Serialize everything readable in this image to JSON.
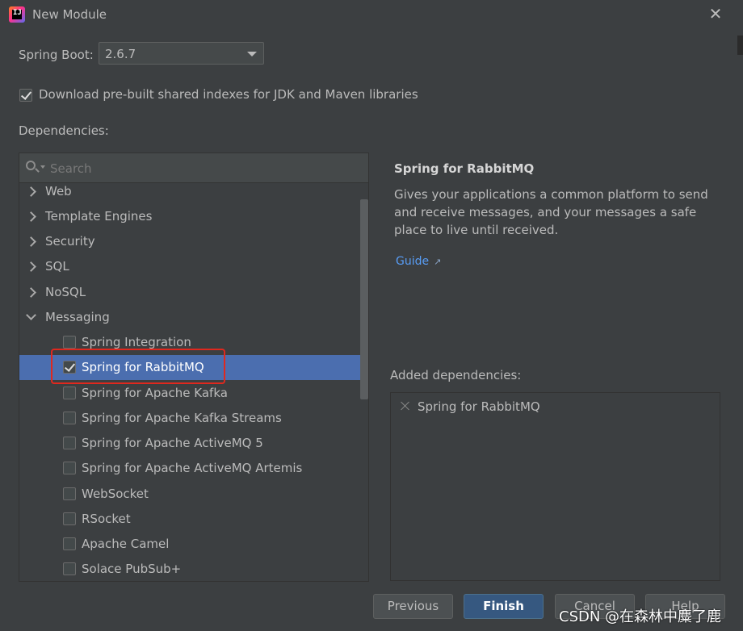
{
  "window": {
    "title": "New Module",
    "app_icon_text": "IJ"
  },
  "spring_boot": {
    "label": "Spring Boot:",
    "value": "2.6.7"
  },
  "download_indexes": {
    "label": "Download pre-built shared indexes for JDK and Maven libraries",
    "checked": true
  },
  "dependencies": {
    "label": "Dependencies:",
    "search": {
      "placeholder": "Search"
    },
    "categories": [
      {
        "label": "Web",
        "expanded": false
      },
      {
        "label": "Template Engines",
        "expanded": false
      },
      {
        "label": "Security",
        "expanded": false
      },
      {
        "label": "SQL",
        "expanded": false
      },
      {
        "label": "NoSQL",
        "expanded": false
      },
      {
        "label": "Messaging",
        "expanded": true
      }
    ],
    "messaging_items": [
      {
        "label": "Spring Integration",
        "checked": false
      },
      {
        "label": "Spring for RabbitMQ",
        "checked": true,
        "selected": true
      },
      {
        "label": "Spring for Apache Kafka",
        "checked": false
      },
      {
        "label": "Spring for Apache Kafka Streams",
        "checked": false
      },
      {
        "label": "Spring for Apache ActiveMQ 5",
        "checked": false
      },
      {
        "label": "Spring for Apache ActiveMQ Artemis",
        "checked": false
      },
      {
        "label": "WebSocket",
        "checked": false
      },
      {
        "label": "RSocket",
        "checked": false
      },
      {
        "label": "Apache Camel",
        "checked": false
      },
      {
        "label": "Solace PubSub+",
        "checked": false
      }
    ]
  },
  "detail": {
    "title": "Spring for RabbitMQ",
    "description": "Gives your applications a common platform to send and receive messages, and your messages a safe place to live until received.",
    "guide_label": "Guide",
    "guide_icon": "external-link-icon"
  },
  "added": {
    "label": "Added dependencies:",
    "items": [
      "Spring for RabbitMQ"
    ]
  },
  "buttons": {
    "previous": "Previous",
    "finish": "Finish",
    "cancel": "Cancel",
    "help": "Help"
  },
  "watermark": "CSDN @在森林中麋了鹿",
  "colors": {
    "background": "#3c3f41",
    "selection": "#4b6eaf",
    "primary_button": "#365880",
    "link": "#589df6",
    "highlight_box": "#e0281e"
  }
}
